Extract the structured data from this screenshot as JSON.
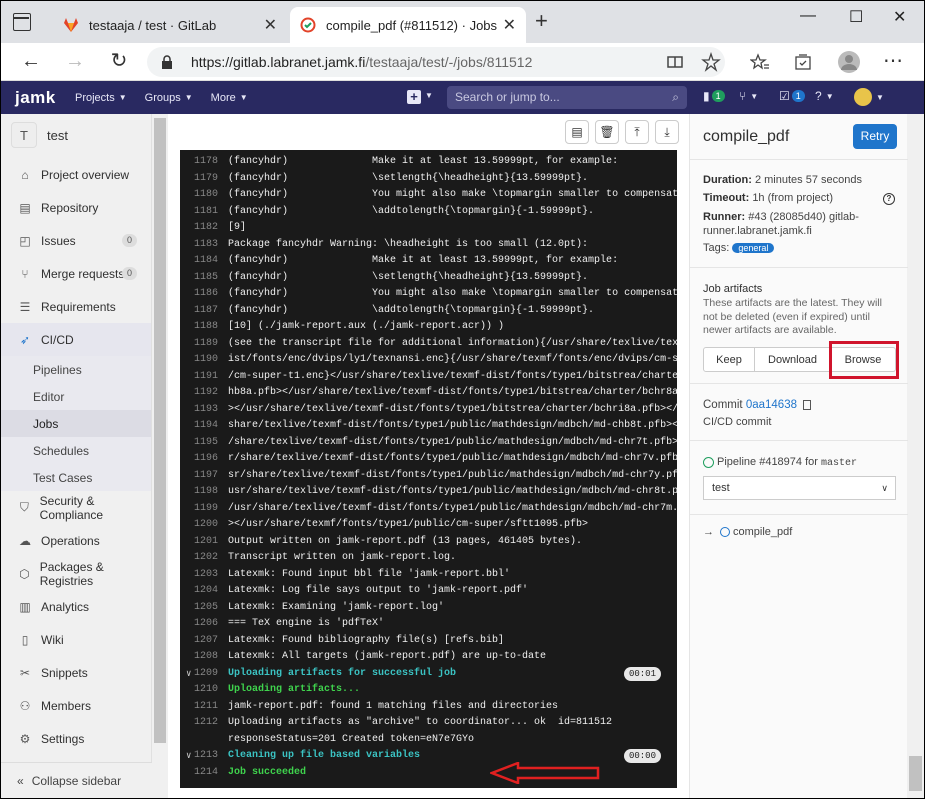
{
  "browser": {
    "tabs": [
      {
        "title": "testaaja / test · GitLab",
        "active": false
      },
      {
        "title": "compile_pdf (#811512) · Jobs · te",
        "active": true
      }
    ],
    "url_host": "https://gitlab.labranet.jamk.fi",
    "url_path": "/testaaja/test/-/jobs/811512"
  },
  "topnav": {
    "logo": "jamk",
    "menus": [
      "Projects",
      "Groups",
      "More"
    ],
    "search_placeholder": "Search or jump to...",
    "issues_badge": "1",
    "todo_badge": "1"
  },
  "sidebar": {
    "project_initial": "T",
    "project_name": "test",
    "items": [
      {
        "label": "Project overview",
        "icon": "home-icon"
      },
      {
        "label": "Repository",
        "icon": "doc-icon"
      },
      {
        "label": "Issues",
        "icon": "issues-icon",
        "count": "0"
      },
      {
        "label": "Merge requests",
        "icon": "merge-icon",
        "count": "0"
      },
      {
        "label": "Requirements",
        "icon": "list-icon"
      },
      {
        "label": "CI/CD",
        "icon": "rocket-icon"
      }
    ],
    "cicd_sub": [
      "Pipelines",
      "Editor",
      "Jobs",
      "Schedules",
      "Test Cases"
    ],
    "items2": [
      {
        "label": "Security & Compliance",
        "icon": "shield-icon"
      },
      {
        "label": "Operations",
        "icon": "cloud-icon"
      },
      {
        "label": "Packages & Registries",
        "icon": "package-icon"
      },
      {
        "label": "Analytics",
        "icon": "chart-icon"
      },
      {
        "label": "Wiki",
        "icon": "book-icon"
      },
      {
        "label": "Snippets",
        "icon": "scissors-icon"
      },
      {
        "label": "Members",
        "icon": "users-icon"
      },
      {
        "label": "Settings",
        "icon": "gear-icon"
      }
    ],
    "collapse_label": "Collapse sidebar"
  },
  "log": [
    {
      "n": "1178",
      "t": "(fancyhdr)              Make it at least 13.59999pt, for example:"
    },
    {
      "n": "1179",
      "t": "(fancyhdr)              \\setlength{\\headheight}{13.59999pt}."
    },
    {
      "n": "1180",
      "t": "(fancyhdr)              You might also make \\topmargin smaller to compensate:"
    },
    {
      "n": "1181",
      "t": "(fancyhdr)              \\addtolength{\\topmargin}{-1.59999pt}."
    },
    {
      "n": "1182",
      "t": "[9]"
    },
    {
      "n": "1183",
      "t": "Package fancyhdr Warning: \\headheight is too small (12.0pt):"
    },
    {
      "n": "1184",
      "t": "(fancyhdr)              Make it at least 13.59999pt, for example:"
    },
    {
      "n": "1185",
      "t": "(fancyhdr)              \\setlength{\\headheight}{13.59999pt}."
    },
    {
      "n": "1186",
      "t": "(fancyhdr)              You might also make \\topmargin smaller to compensate:"
    },
    {
      "n": "1187",
      "t": "(fancyhdr)              \\addtolength{\\topmargin}{-1.59999pt}."
    },
    {
      "n": "1188",
      "t": "[10] (./jamk-report.aux (./jamk-report.acr)) )"
    },
    {
      "n": "1189",
      "t": "(see the transcript file for additional information){/usr/share/texlive/texmf-d"
    },
    {
      "n": "1190",
      "t": "ist/fonts/enc/dvips/ly1/texnansi.enc}{/usr/share/texmf/fonts/enc/dvips/cm-super"
    },
    {
      "n": "1191",
      "t": "/cm-super-t1.enc}</usr/share/texlive/texmf-dist/fonts/type1/bitstrea/charter/bc"
    },
    {
      "n": "1192",
      "t": "hb8a.pfb></usr/share/texlive/texmf-dist/fonts/type1/bitstrea/charter/bchr8a.pfb"
    },
    {
      "n": "1193",
      "t": "></usr/share/texlive/texmf-dist/fonts/type1/bitstrea/charter/bchri8a.pfb></usr/"
    },
    {
      "n": "1194",
      "t": "share/texlive/texmf-dist/fonts/type1/public/mathdesign/mdbch/md-chb8t.pfb></usr"
    },
    {
      "n": "1195",
      "t": "/share/texlive/texmf-dist/fonts/type1/public/mathdesign/mdbch/md-chr7t.pfb></us"
    },
    {
      "n": "1196",
      "t": "r/share/texlive/texmf-dist/fonts/type1/public/mathdesign/mdbch/md-chr7v.pfb></u"
    },
    {
      "n": "1197",
      "t": "sr/share/texlive/texmf-dist/fonts/type1/public/mathdesign/mdbch/md-chr7y.pfb></"
    },
    {
      "n": "1198",
      "t": "usr/share/texlive/texmf-dist/fonts/type1/public/mathdesign/mdbch/md-chr8t.pfb><"
    },
    {
      "n": "1199",
      "t": "/usr/share/texlive/texmf-dist/fonts/type1/public/mathdesign/mdbch/md-chr7m.pfb"
    },
    {
      "n": "1200",
      "t": "></usr/share/texmf/fonts/type1/public/cm-super/sftt1095.pfb>"
    },
    {
      "n": "1201",
      "t": "Output written on jamk-report.pdf (13 pages, 461405 bytes)."
    },
    {
      "n": "1202",
      "t": "Transcript written on jamk-report.log."
    },
    {
      "n": "1203",
      "t": "Latexmk: Found input bbl file 'jamk-report.bbl'"
    },
    {
      "n": "1204",
      "t": "Latexmk: Log file says output to 'jamk-report.pdf'"
    },
    {
      "n": "1205",
      "t": "Latexmk: Examining 'jamk-report.log'"
    },
    {
      "n": "1206",
      "t": "=== TeX engine is 'pdfTeX'"
    },
    {
      "n": "1207",
      "t": "Latexmk: Found bibliography file(s) [refs.bib]"
    },
    {
      "n": "1208",
      "t": "Latexmk: All targets (jamk-report.pdf) are up-to-date"
    }
  ],
  "log_tail": {
    "s1": {
      "n": "1209",
      "t": "Uploading artifacts for successful job",
      "dur": "00:01"
    },
    "l1210": {
      "n": "1210",
      "t": "Uploading artifacts..."
    },
    "l1211": {
      "n": "1211",
      "t": "jamk-report.pdf: found 1 matching files and directories"
    },
    "l1212": {
      "n": "1212",
      "t": "Uploading artifacts as \"archive\" to coordinator... ok  id=811512 responseStatus=201 Created token=eN7e7GYo"
    },
    "s2": {
      "n": "1213",
      "t": "Cleaning up file based variables",
      "dur": "00:00"
    },
    "l1214": {
      "n": "1214",
      "t": "Job succeeded"
    }
  },
  "job": {
    "title": "compile_pdf",
    "retry_label": "Retry",
    "duration_label": "Duration:",
    "duration": "2 minutes 57 seconds",
    "timeout_label": "Timeout:",
    "timeout": "1h (from project)",
    "runner_label": "Runner:",
    "runner": "#43 (28085d40) gitlab-runner.labranet.jamk.fi",
    "tags_label": "Tags:",
    "tag": "general",
    "artifacts_title": "Job artifacts",
    "artifacts_desc": "These artifacts are the latest. They will not be deleted (even if expired) until newer artifacts are available.",
    "keep": "Keep",
    "download": "Download",
    "browse": "Browse",
    "commit_label": "Commit",
    "commit_sha": "0aa14638",
    "commit_msg": "CI/CD commit",
    "pipeline_label": "Pipeline",
    "pipeline_id": "#418974",
    "pipeline_for": "for",
    "pipeline_ref": "master",
    "stage_select": "test",
    "job_link": "compile_pdf"
  }
}
